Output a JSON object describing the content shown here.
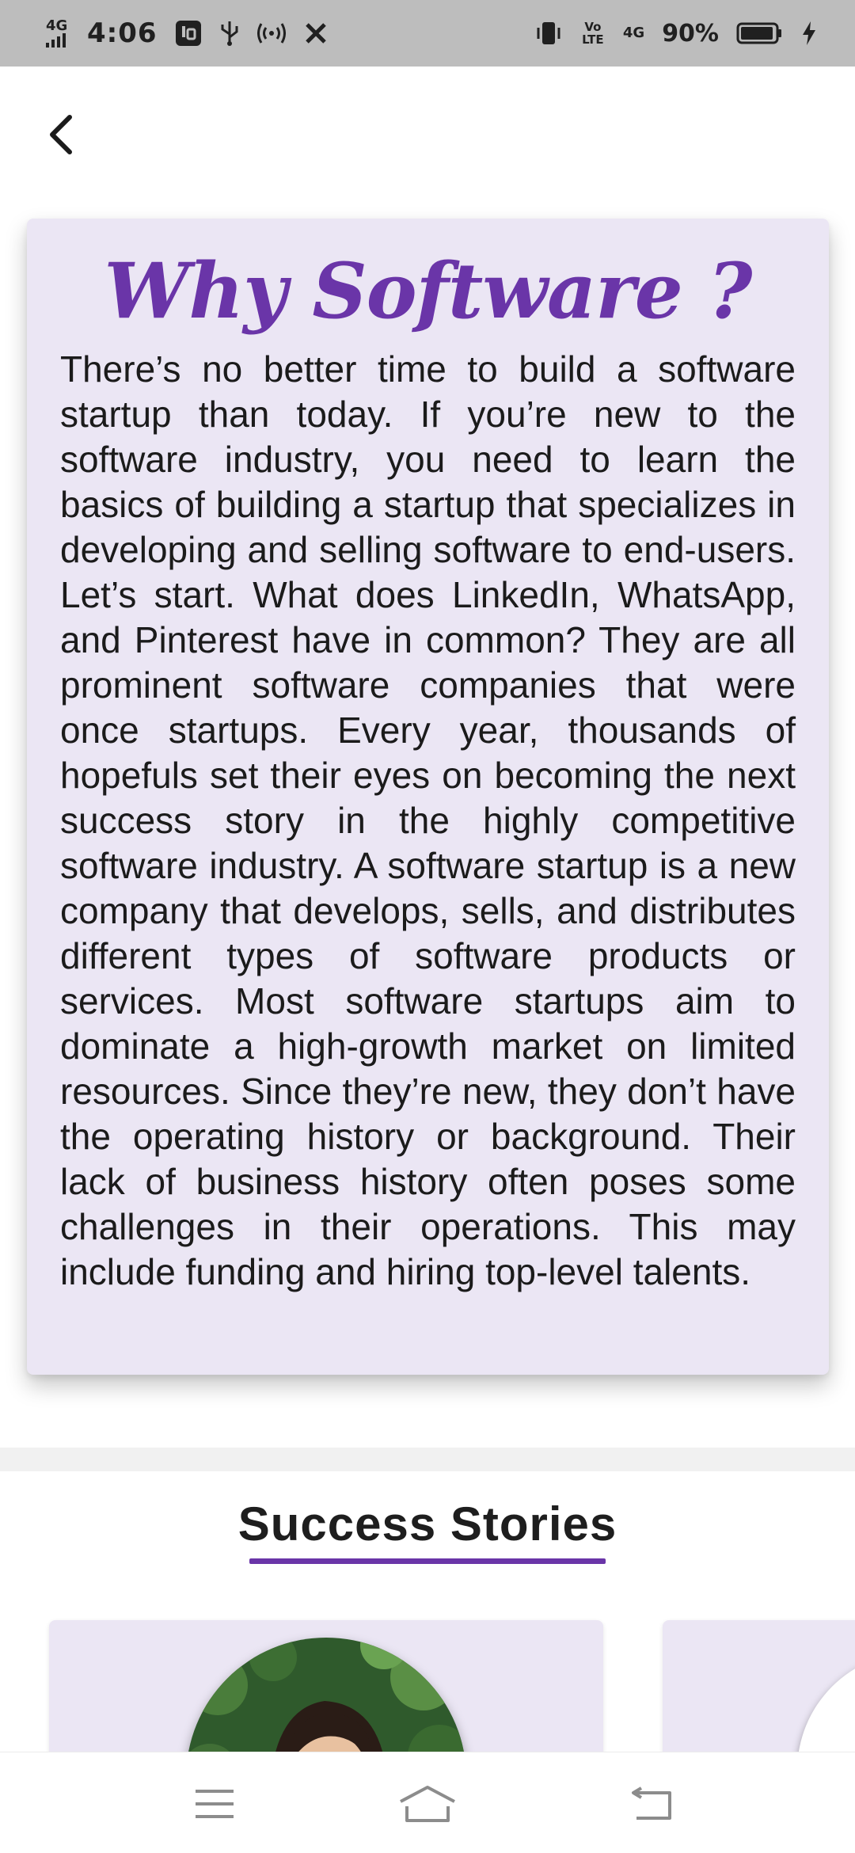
{
  "status_bar": {
    "network_left": "4G",
    "time": "4:06",
    "volte": "Vo LTE",
    "network_right": "4G",
    "battery_percent": "90%",
    "icons": [
      "signal-icon",
      "app-notification-icon",
      "usb-icon",
      "hotspot-icon",
      "tools-icon",
      "vibrate-icon",
      "volte-icon",
      "battery-icon",
      "charging-icon"
    ]
  },
  "header": {
    "back_icon": "chevron-left-icon"
  },
  "why_card": {
    "title": "Why Software ?",
    "body": "There’s no better time to build a software startup than today. If you’re new to the software industry, you need to learn the basics of building a startup that specializes in developing and selling software to end-users. Let’s start. What does LinkedIn, WhatsApp, and Pinterest have in common? They are all prominent software companies that were once startups. Every year, thousands of hopefuls set their eyes on becoming the next success story in the highly competitive software industry. A software startup is a new company that develops, sells, and distributes different types of software products or services. Most software startups aim to dominate a high-growth market on limited resources. Since they’re new, they don’t have the operating history or background. Their lack of business history often poses some challenges in their operations. This may include funding and hiring top-level talents."
  },
  "success_stories": {
    "heading": "Success Stories",
    "cards": [
      {
        "avatar": "person-photo"
      },
      {
        "avatar": "person-photo"
      }
    ]
  },
  "nav_bar": {
    "buttons": [
      "menu-icon",
      "home-icon",
      "back-icon"
    ]
  },
  "colors": {
    "accent": "#6a35a8",
    "card_background": "#ebe6f4",
    "status_bar": "#bdbdbd"
  }
}
